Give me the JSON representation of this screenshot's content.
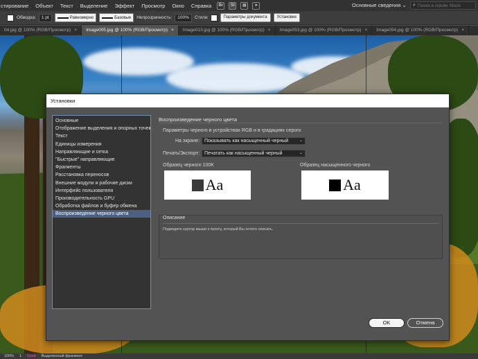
{
  "menubar": {
    "items": [
      "стирование",
      "Объект",
      "Текст",
      "Выделение",
      "Эффект",
      "Просмотр",
      "Окно",
      "Справка"
    ],
    "icon_br": "Br",
    "icon_st": "St",
    "workspace": "Основные сведения",
    "stock_search_placeholder": "Поиск в Adobe Stock"
  },
  "controlbar": {
    "stroke_label": "Обводка:",
    "stroke_weight": "1 pt",
    "stroke_style_1": "Равномерно",
    "stroke_style_2": "Базовые",
    "opacity_label": "Непрозрачность:",
    "opacity_value": "100%",
    "styles_label": "Стили",
    "doc_settings_button": "Параметры документа",
    "prefs_button": "Установки"
  },
  "tabs": [
    {
      "label": "04.jpg @ 100% (RGB/Просмотр)",
      "active": false
    },
    {
      "label": "Image005.jpg @ 100% (RGB/Просмотр)",
      "active": true
    },
    {
      "label": "Image013.jpg @ 100% (RGB/Просмотр)",
      "active": false
    },
    {
      "label": "Image053.jpg @ 100% (RGB/Просмотр)",
      "active": false
    },
    {
      "label": "Image054.jpg @ 100% (RGB/Просмотр)",
      "active": false
    }
  ],
  "statusbar": {
    "zoom": "100%",
    "page": "1",
    "tag": "Край",
    "selection": "Выделенный фрагмент"
  },
  "dialog": {
    "title": "Установки",
    "categories": [
      "Основные",
      "Отображение выделения и опорных точек",
      "Текст",
      "Единицы измерения",
      "Направляющие и сетка",
      "\"Быстрые\" направляющие",
      "Фрагменты",
      "Расстановка переносов",
      "Внешние модули и рабочие диски",
      "Интерфейс пользователя",
      "Производительность GPU",
      "Обработка файлов и буфер обмена",
      "Воспроизведение черного цвета"
    ],
    "selected_index": 12,
    "panel_title": "Воспроизведение черного цвета",
    "group_label": "Параметры черного в устройствах RGB и в градациях серого",
    "on_screen_label": "На экране:",
    "on_screen_value": "Показывать как насыщенный черный",
    "print_label": "Печать/Экспорт:",
    "print_value": "Печатать как насыщенный черный",
    "sample1_label": "Образец черного 100K",
    "sample2_label": "Образец насыщенного черного",
    "sample_text": "Aa",
    "sample1_color": "#3a3a3a",
    "sample2_color": "#000000",
    "description_title": "Описание",
    "description_text": "Подведите курсор мыши к пункту, который Вы хотите описать.",
    "ok_button": "OK",
    "cancel_button": "Отмена"
  }
}
